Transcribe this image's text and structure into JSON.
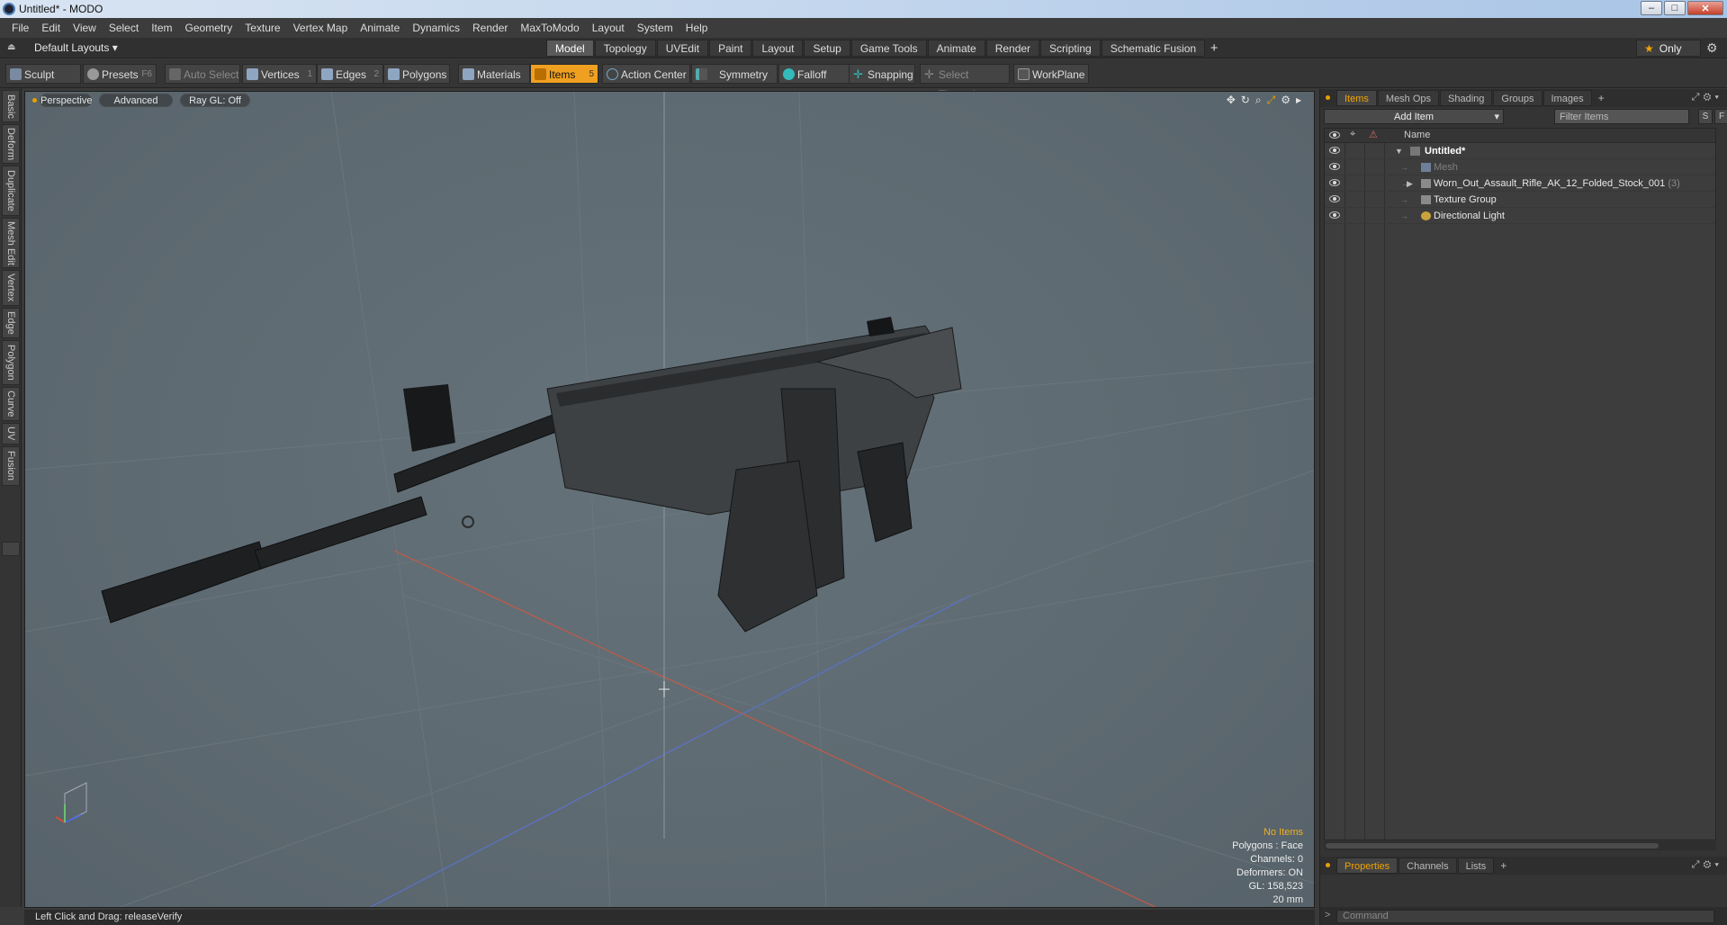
{
  "window": {
    "title": "Untitled* - MODO",
    "min": "–",
    "max": "□",
    "close": "✕"
  },
  "menu": [
    "File",
    "Edit",
    "View",
    "Select",
    "Item",
    "Geometry",
    "Texture",
    "Vertex Map",
    "Animate",
    "Dynamics",
    "Render",
    "MaxToModo",
    "Layout",
    "System",
    "Help"
  ],
  "layout": {
    "selector": "Default Layouts ▾",
    "tabs": [
      "Model",
      "Topology",
      "UVEdit",
      "Paint",
      "Layout",
      "Setup",
      "Game Tools",
      "Animate",
      "Render",
      "Scripting",
      "Schematic Fusion"
    ],
    "active_tab": "Model",
    "add": "+",
    "only": "Only"
  },
  "toolbar": {
    "sculpt": "Sculpt",
    "presets": "Presets",
    "presets_key": "F6",
    "auto_select": "Auto Select",
    "vertices": "Vertices",
    "vertices_key": "1",
    "edges": "Edges",
    "edges_key": "2",
    "polygons": "Polygons",
    "materials": "Materials",
    "items": "Items",
    "items_key": "5",
    "action_center": "Action Center",
    "symmetry": "Symmetry",
    "falloff": "Falloff",
    "snapping": "Snapping",
    "select_through": "Select Through",
    "workplane": "WorkPlane"
  },
  "side_tabs": [
    "Basic",
    "Deform",
    "Duplicate",
    "Mesh Edit",
    "Vertex",
    "Edge",
    "Polygon",
    "Curve",
    "UV",
    "Fusion"
  ],
  "viewport": {
    "view": "Perspective",
    "shading": "Advanced",
    "raygl": "Ray GL: Off",
    "info": {
      "no_items": "No Items",
      "polygons": "Polygons : Face",
      "channels": "Channels: 0",
      "deformers": "Deformers: ON",
      "gl": "GL: 158,523",
      "scale": "20 mm"
    }
  },
  "status": "Left Click and Drag:   releaseVerify",
  "items_panel": {
    "tabs": [
      "Items",
      "Mesh Ops",
      "Shading",
      "Groups",
      "Images"
    ],
    "active_tab": "Items",
    "add": "+",
    "add_item": "Add Item",
    "filter_placeholder": "Filter Items",
    "s": "S",
    "f": "F",
    "col_name": "Name",
    "rows": [
      {
        "label": "Untitled*",
        "count": ""
      },
      {
        "label": "Mesh",
        "count": ""
      },
      {
        "label": "Worn_Out_Assault_Rifle_AK_12_Folded_Stock_001",
        "count": "(3)"
      },
      {
        "label": "Texture Group",
        "count": ""
      },
      {
        "label": "Directional Light",
        "count": ""
      }
    ]
  },
  "bottom_panel": {
    "tabs": [
      "Properties",
      "Channels",
      "Lists"
    ],
    "active_tab": "Properties",
    "add": "+",
    "command_placeholder": "Command"
  },
  "colors": {
    "accent": "#f0a300",
    "viewport_bg": "#5e6a71",
    "axis_x": "#d0503a",
    "axis_z": "#4a6ad8"
  }
}
